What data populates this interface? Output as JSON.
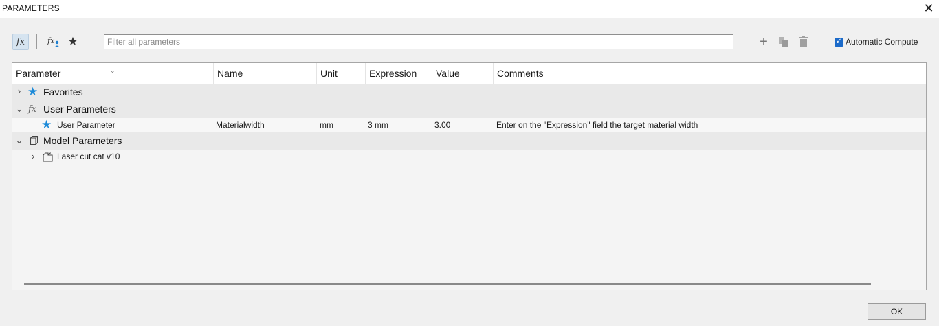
{
  "window": {
    "title": "PARAMETERS",
    "close_icon": "close-icon"
  },
  "toolbar": {
    "fx_icon_label": "fx",
    "user_fx_icon_label": "fx",
    "filter_placeholder": "Filter all parameters",
    "add_icon": "plus-icon",
    "copy_icon": "copy-icon",
    "delete_icon": "trash-icon",
    "auto_compute_label": "Automatic Compute",
    "auto_compute_checked": true
  },
  "columns": [
    "Parameter",
    "Name",
    "Unit",
    "Expression",
    "Value",
    "Comments"
  ],
  "groups": {
    "favorites": {
      "label": "Favorites",
      "expanded": false
    },
    "user_parameters": {
      "label": "User Parameters",
      "expanded": true
    },
    "model_parameters": {
      "label": "Model Parameters",
      "expanded": true
    }
  },
  "user_rows": [
    {
      "parameter": "User Parameter",
      "name": "Materialwidth",
      "unit": "mm",
      "expression": "3 mm",
      "value": "3.00",
      "comments": "Enter on the \"Expression\" field the target material width"
    }
  ],
  "model_rows": [
    {
      "label": "Laser cut cat v10",
      "expanded": false
    }
  ],
  "footer": {
    "ok_label": "OK"
  },
  "colors": {
    "accent": "#1b6ac9",
    "star": "#1c8ad8"
  }
}
